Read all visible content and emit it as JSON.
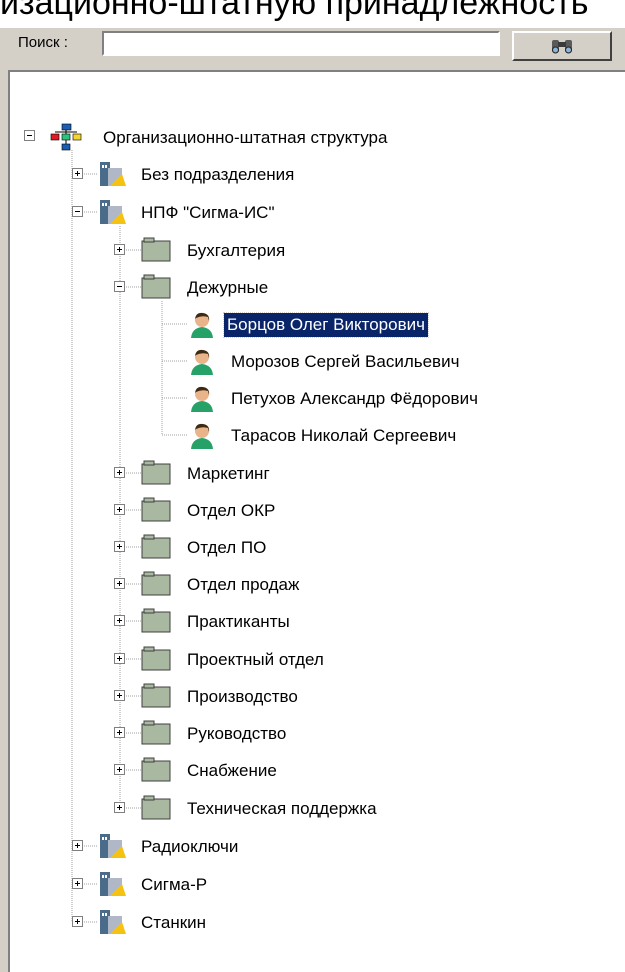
{
  "title_fragment": "изационно-штатную принадлежность",
  "search": {
    "label": "Поиск :",
    "value": "",
    "button_icon": "binoculars-icon"
  },
  "tree": {
    "root": "Организационно-штатная структура",
    "top_level": [
      "Без подразделения",
      "НПФ \"Сигма-ИС\"",
      "Радиоключи",
      "Сигма-Р",
      "Станкин"
    ],
    "departments": [
      "Бухгалтерия",
      "Дежурные",
      "Маркетинг",
      "Отдел ОКР",
      "Отдел ПО",
      "Отдел продаж",
      "Практиканты",
      "Проектный отдел",
      "Производство",
      "Руководство",
      "Снабжение",
      "Техническая поддержка"
    ],
    "employees": [
      "Борцов Олег Викторович",
      "Морозов Сергей Васильевич",
      "Петухов Александр Фёдорович",
      "Тарасов Николай Сергеевич"
    ],
    "selected": "Борцов Олег Викторович"
  }
}
